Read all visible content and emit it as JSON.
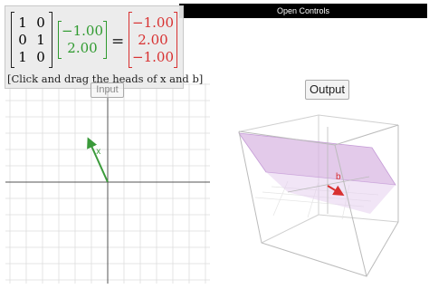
{
  "controls": {
    "label": "Open Controls"
  },
  "matrix": {
    "A": [
      [
        "1",
        "0"
      ],
      [
        "0",
        "1"
      ],
      [
        "1",
        "0"
      ]
    ],
    "x": [
      "−1.00",
      "2.00"
    ],
    "equals": "=",
    "b": [
      "−1.00",
      "2.00",
      "−1.00"
    ]
  },
  "hint": "[Click and drag the heads of x and b]",
  "buttons": {
    "input": "Input",
    "output": "Output"
  },
  "vectors": {
    "x_label": "x",
    "b_label": "b",
    "x": [
      -1.0,
      2.0
    ],
    "b": [
      -1.0,
      2.0,
      -1.0
    ]
  },
  "colors": {
    "x_vector": "#3a9a3a",
    "b_vector": "#d83030",
    "plane": "#d9b8e3",
    "grid": "#dddddd",
    "axis": "#555555"
  }
}
